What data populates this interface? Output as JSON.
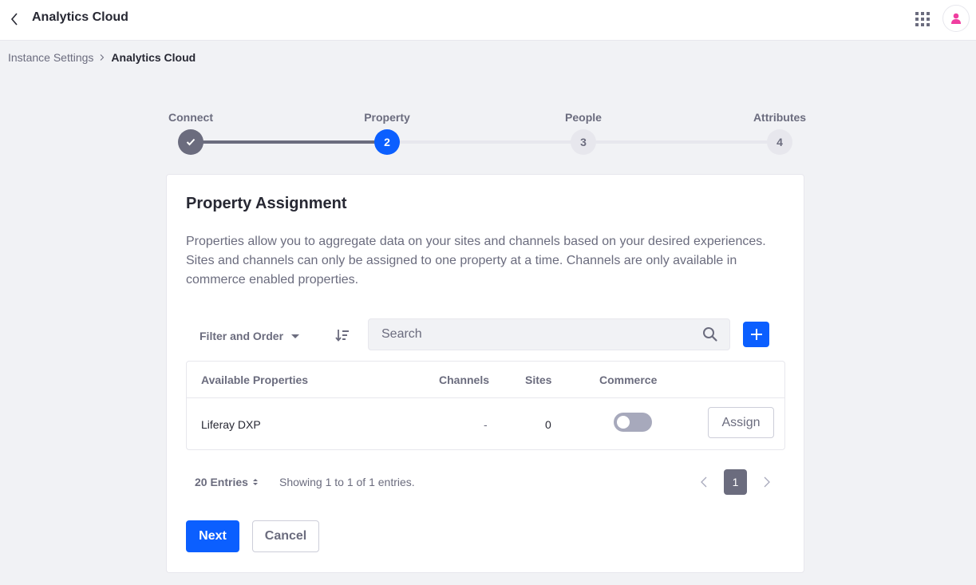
{
  "header": {
    "title": "Analytics Cloud",
    "icons": {
      "back": "angle-left-icon",
      "apps": "apps-grid-icon",
      "user": "user-avatar-icon"
    }
  },
  "breadcrumb": {
    "items": [
      {
        "label": "Instance Settings"
      },
      {
        "label": "Analytics Cloud"
      }
    ]
  },
  "stepper": {
    "steps": [
      {
        "label": "Connect",
        "number": "1",
        "status": "complete"
      },
      {
        "label": "Property",
        "number": "2",
        "status": "active"
      },
      {
        "label": "People",
        "number": "3",
        "status": "pending"
      },
      {
        "label": "Attributes",
        "number": "4",
        "status": "pending"
      }
    ]
  },
  "card": {
    "title": "Property Assignment",
    "description": "Properties allow you to aggregate data on your sites and channels based on your desired experiences. Sites and channels can only be assigned to one property at a time. Channels are only available in commerce enabled properties."
  },
  "toolbar": {
    "filter_label": "Filter and Order",
    "search_placeholder": "Search",
    "search_value": ""
  },
  "table": {
    "columns": [
      "Available Properties",
      "Channels",
      "Sites",
      "Commerce"
    ],
    "rows": [
      {
        "name": "Liferay DXP",
        "channels": "-",
        "sites": "0",
        "commerce_enabled": false,
        "action": "Assign"
      }
    ]
  },
  "pagination": {
    "entries_label": "20 Entries",
    "showing_text": "Showing 1 to 1 of 1 entries.",
    "current_page": "1"
  },
  "actions": {
    "next": "Next",
    "cancel": "Cancel"
  },
  "colors": {
    "primary": "#0b5fff",
    "secondary": "#6b6c7e",
    "avatar": "#f03ea0"
  }
}
